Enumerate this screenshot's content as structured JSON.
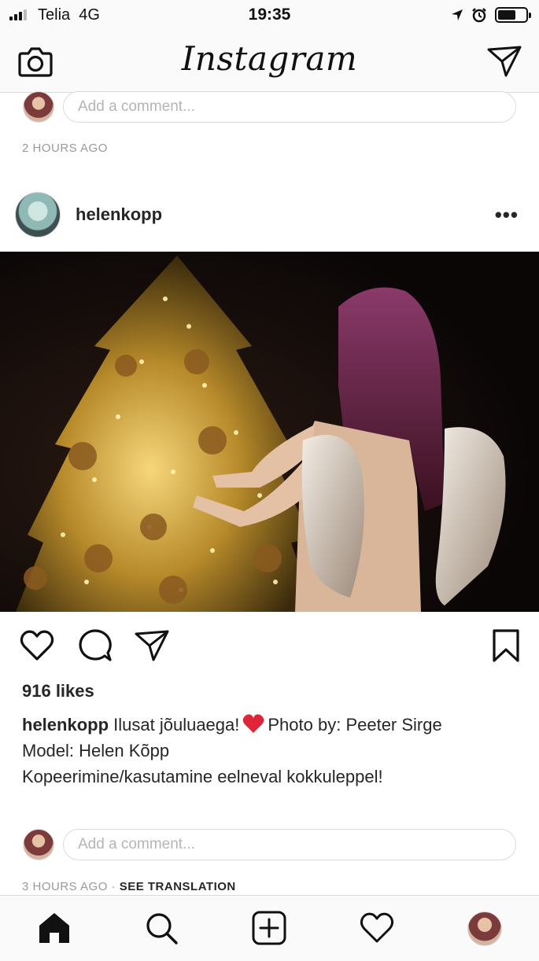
{
  "status_bar": {
    "carrier": "Telia",
    "network": "4G",
    "time": "19:35",
    "battery_level": 0.65,
    "icons": [
      "signal-icon",
      "location-arrow-icon",
      "alarm-icon",
      "battery-icon"
    ]
  },
  "nav": {
    "title": "Instagram",
    "left_icon": "camera-icon",
    "right_icon": "direct-message-icon"
  },
  "previous_post": {
    "comment_placeholder": "Add a comment...",
    "timestamp": "2 HOURS AGO"
  },
  "post": {
    "username": "helenkopp",
    "more_label": "•••",
    "image_description_icon": "photo",
    "likes": "916 likes",
    "caption": {
      "username": "helenkopp",
      "text_part1": "Ilusat jõuluaega!",
      "emoji": "heart-emoji",
      "text_part2": "Photo by: Peeter Sirge",
      "line2": "Model: Helen Kõpp",
      "line3": "Kopeerimine/kasutamine eelneval kokkuleppel!"
    },
    "comment_placeholder": "Add a comment...",
    "timestamp": "3 HOURS AGO",
    "separator": " · ",
    "see_translation": "SEE TRANSLATION",
    "actions": [
      "heart-icon",
      "comment-icon",
      "share-icon",
      "bookmark-icon"
    ]
  },
  "tab_bar": {
    "items": [
      "home-icon",
      "search-icon",
      "add-post-icon",
      "activity-heart-icon",
      "profile-avatar"
    ]
  },
  "colors": {
    "text": "#262626",
    "muted": "#999999",
    "border": "#dbdbdb",
    "heart_red": "#e0243a"
  }
}
